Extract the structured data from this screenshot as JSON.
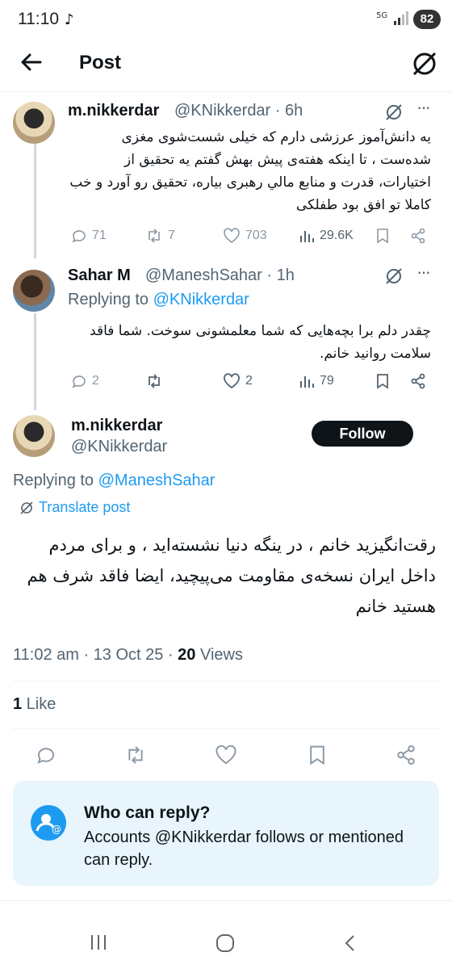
{
  "status_bar": {
    "time": "11:10",
    "network": "5G",
    "battery": "82"
  },
  "header": {
    "title": "Post"
  },
  "thread": [
    {
      "name": "m.nikkerdar",
      "handle": "@KNikkerdar · 6h",
      "text": "یه دانش‌آموز عرزشی دارم که خیلی شست‌شوی مغزی شده‌ست ، تا اینکه هفته‌ی پیش بهش گفتم یه تحقیق از اختیارات، قدرت و منابع مالي رهبری بیاره، تحقیق رو آورد و خب کاملا تو افق بود طفلکی",
      "replies": "71",
      "reposts": "7",
      "likes": "703",
      "views": "29.6K"
    },
    {
      "name": "Sahar M",
      "handle": "@ManeshSahar · 1h",
      "replying_prefix": "Replying to ",
      "replying_to": "@KNikkerdar",
      "text": "چقدر دلم برا بچه‌هایی که شما معلمشونی سوخت. شما فاقد سلامت روانید خانم.",
      "replies": "2",
      "likes": "2",
      "views": "79"
    }
  ],
  "main_post": {
    "name": "m.nikkerdar",
    "handle": "@KNikkerdar",
    "follow_label": "Follow",
    "replying_prefix": "Replying to ",
    "replying_to": "@ManeshSahar",
    "translate_label": "Translate post",
    "text": "رقت‌انگیزید خانم ، در ینگه دنیا نشسته‌اید ، و برای مردم داخل ایران نسخه‌ی مقاومت می‌پیچید، ایضا فاقد شرف هم هستید خانم",
    "timestamp": "11:02 am · 13 Oct 25 · ",
    "views_count": "20",
    "views_label": " Views",
    "likes_count": "1",
    "likes_label": " Like"
  },
  "reply_settings": {
    "title": "Who can reply?",
    "description": "Accounts @KNikkerdar follows or mentioned can reply."
  },
  "colors": {
    "accent": "#1d9bf0",
    "text": "#0f1419",
    "muted": "#536471"
  }
}
